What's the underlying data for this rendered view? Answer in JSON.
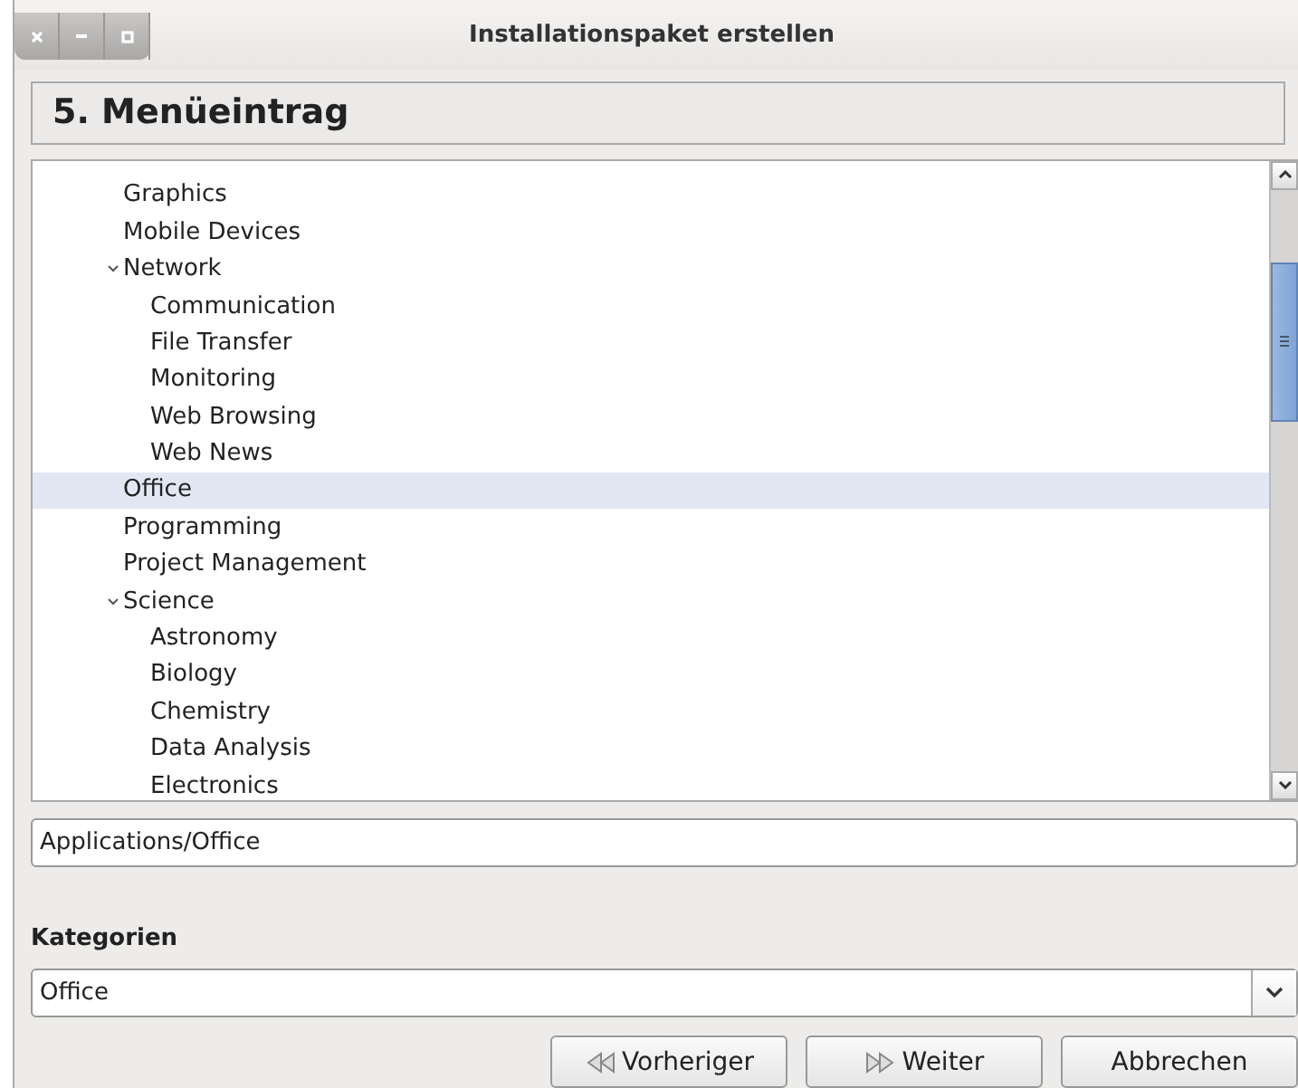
{
  "window": {
    "title": "Installationspaket erstellen"
  },
  "page_title": "5. Menüeintrag",
  "tree": [
    {
      "label": "Graphics",
      "selected": false
    },
    {
      "label": "Mobile Devices",
      "selected": false
    },
    {
      "label": "Network",
      "selected": false,
      "expanded": true,
      "children": [
        {
          "label": "Communication",
          "selected": false
        },
        {
          "label": "File Transfer",
          "selected": false
        },
        {
          "label": "Monitoring",
          "selected": false
        },
        {
          "label": "Web Browsing",
          "selected": false
        },
        {
          "label": "Web News",
          "selected": false
        }
      ]
    },
    {
      "label": "Office",
      "selected": true
    },
    {
      "label": "Programming",
      "selected": false
    },
    {
      "label": "Project Management",
      "selected": false
    },
    {
      "label": "Science",
      "selected": false,
      "expanded": true,
      "children": [
        {
          "label": "Astronomy",
          "selected": false
        },
        {
          "label": "Biology",
          "selected": false
        },
        {
          "label": "Chemistry",
          "selected": false
        },
        {
          "label": "Data Analysis",
          "selected": false
        },
        {
          "label": "Electronics",
          "selected": false
        }
      ]
    }
  ],
  "path_field": {
    "value": "Applications/Office"
  },
  "categories": {
    "label": "Kategorien",
    "value": "Office"
  },
  "buttons": [
    {
      "label": "Vorheriger",
      "kind": "back"
    },
    {
      "label": "Weiter",
      "kind": "next"
    },
    {
      "label": "Abbrechen",
      "kind": "plain"
    }
  ]
}
